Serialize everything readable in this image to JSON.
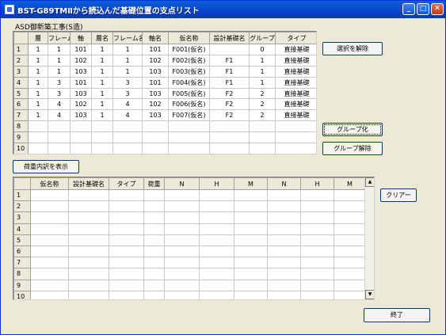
{
  "window": {
    "title": "BST-G89TMⅡから読込んだ基礎位置の支点リスト",
    "minimize": "_",
    "maximize": "□",
    "close": "✕"
  },
  "top_grid": {
    "caption": "ASD御新築工事(S造)",
    "headers": [
      "",
      "層",
      "フレーム",
      "軸",
      "層名",
      "フレーム名",
      "軸名",
      "仮名称",
      "設計基礎名",
      "グループ",
      "タイプ"
    ],
    "rows": [
      [
        "1",
        "1",
        "1",
        "101",
        "1",
        "1",
        "101",
        "F001(仮名)",
        "",
        "0",
        "直接基礎"
      ],
      [
        "2",
        "1",
        "1",
        "102",
        "1",
        "1",
        "102",
        "F002(仮名)",
        "F1",
        "1",
        "直接基礎"
      ],
      [
        "3",
        "1",
        "1",
        "103",
        "1",
        "1",
        "103",
        "F003(仮名)",
        "F1",
        "1",
        "直接基礎"
      ],
      [
        "4",
        "1",
        "3",
        "101",
        "1",
        "3",
        "101",
        "F004(仮名)",
        "F1",
        "1",
        "直接基礎"
      ],
      [
        "5",
        "1",
        "3",
        "103",
        "1",
        "3",
        "103",
        "F005(仮名)",
        "F2",
        "2",
        "直接基礎"
      ],
      [
        "6",
        "1",
        "4",
        "102",
        "1",
        "4",
        "102",
        "F006(仮名)",
        "F2",
        "2",
        "直接基礎"
      ],
      [
        "7",
        "1",
        "4",
        "103",
        "1",
        "4",
        "103",
        "F007(仮名)",
        "F2",
        "2",
        "直接基礎"
      ],
      [
        "8",
        "",
        "",
        "",
        "",
        "",
        "",
        "",
        "",
        "",
        ""
      ],
      [
        "9",
        "",
        "",
        "",
        "",
        "",
        "",
        "",
        "",
        "",
        ""
      ],
      [
        "10",
        "",
        "",
        "",
        "",
        "",
        "",
        "",
        "",
        "",
        ""
      ]
    ]
  },
  "buttons": {
    "deselect": "選択を解除",
    "group": "グループ化",
    "ungroup": "グループ解除",
    "show_load": "荷重内訳を表示",
    "clear": "クリアー",
    "exit": "終了"
  },
  "bottom_grid": {
    "headers": [
      "",
      "仮名称",
      "設計基礎名",
      "タイプ",
      "荷重",
      "N",
      "H",
      "M",
      "N",
      "H",
      "M"
    ],
    "row_numbers": [
      "1",
      "2",
      "3",
      "4",
      "5",
      "6",
      "7",
      "8",
      "9",
      "10"
    ]
  }
}
